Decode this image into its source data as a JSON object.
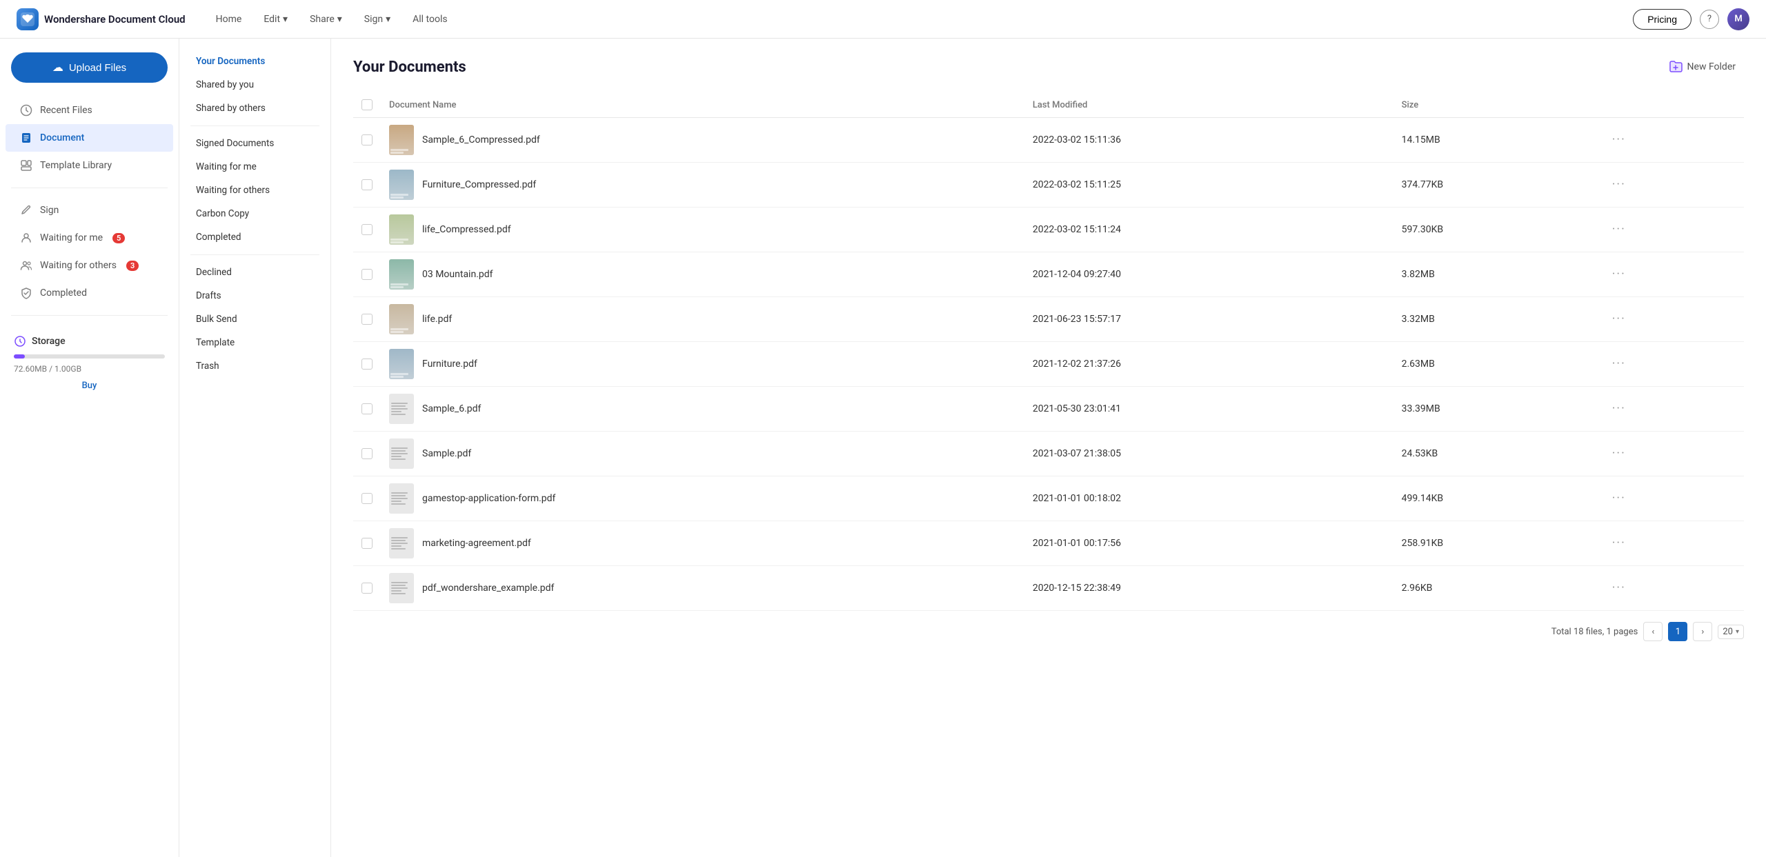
{
  "app": {
    "brand": "Wondershare Document Cloud",
    "brand_icon_text": "W"
  },
  "topnav": {
    "items": [
      {
        "label": "Home",
        "has_dropdown": false
      },
      {
        "label": "Edit",
        "has_dropdown": true
      },
      {
        "label": "Share",
        "has_dropdown": true
      },
      {
        "label": "Sign",
        "has_dropdown": true
      },
      {
        "label": "All tools",
        "has_dropdown": false
      }
    ],
    "pricing_label": "Pricing",
    "help_icon": "?",
    "avatar_text": "M"
  },
  "sidebar": {
    "upload_label": "Upload Files",
    "items": [
      {
        "label": "Recent Files",
        "icon": "clock"
      },
      {
        "label": "Document",
        "icon": "document",
        "active": true
      },
      {
        "label": "Template Library",
        "icon": "template"
      }
    ],
    "sign_items": [
      {
        "label": "Sign",
        "icon": "sign"
      },
      {
        "label": "Waiting for me",
        "icon": "person",
        "badge": "5"
      },
      {
        "label": "Waiting for others",
        "icon": "person-group",
        "badge": "3"
      },
      {
        "label": "Completed",
        "icon": "shield"
      }
    ],
    "storage": {
      "title": "Storage",
      "used": "72.60MB",
      "total": "1.00GB",
      "display": "72.60MB / 1.00GB",
      "percent": 7.28,
      "buy_label": "Buy"
    }
  },
  "second_sidebar": {
    "items": [
      {
        "label": "Your Documents",
        "active": true
      },
      {
        "label": "Shared by you"
      },
      {
        "label": "Shared by others"
      }
    ],
    "signed_section": [
      {
        "label": "Signed Documents"
      },
      {
        "label": "Waiting for me"
      },
      {
        "label": "Waiting for others"
      },
      {
        "label": "Carbon Copy"
      },
      {
        "label": "Completed"
      }
    ],
    "other_section": [
      {
        "label": "Declined"
      },
      {
        "label": "Drafts"
      },
      {
        "label": "Bulk Send"
      },
      {
        "label": "Template"
      },
      {
        "label": "Trash"
      }
    ]
  },
  "content": {
    "title": "Your Documents",
    "new_folder_label": "New Folder",
    "table": {
      "columns": [
        {
          "key": "name",
          "label": "Document Name"
        },
        {
          "key": "modified",
          "label": "Last Modified"
        },
        {
          "key": "size",
          "label": "Size"
        }
      ],
      "rows": [
        {
          "name": "Sample_6_Compressed.pdf",
          "modified": "2022-03-02 15:11:36",
          "size": "14.15MB",
          "thumb_type": "image"
        },
        {
          "name": "Furniture_Compressed.pdf",
          "modified": "2022-03-02 15:11:25",
          "size": "374.77KB",
          "thumb_type": "image"
        },
        {
          "name": "life_Compressed.pdf",
          "modified": "2022-03-02 15:11:24",
          "size": "597.30KB",
          "thumb_type": "image"
        },
        {
          "name": "03 Mountain.pdf",
          "modified": "2021-12-04 09:27:40",
          "size": "3.82MB",
          "thumb_type": "image"
        },
        {
          "name": "life.pdf",
          "modified": "2021-06-23 15:57:17",
          "size": "3.32MB",
          "thumb_type": "image"
        },
        {
          "name": "Furniture.pdf",
          "modified": "2021-12-02 21:37:26",
          "size": "2.63MB",
          "thumb_type": "image"
        },
        {
          "name": "Sample_6.pdf",
          "modified": "2021-05-30 23:01:41",
          "size": "33.39MB",
          "thumb_type": "doc"
        },
        {
          "name": "Sample.pdf",
          "modified": "2021-03-07 21:38:05",
          "size": "24.53KB",
          "thumb_type": "lines"
        },
        {
          "name": "gamestop-application-form.pdf",
          "modified": "2021-01-01 00:18:02",
          "size": "499.14KB",
          "thumb_type": "lines"
        },
        {
          "name": "marketing-agreement.pdf",
          "modified": "2021-01-01 00:17:56",
          "size": "258.91KB",
          "thumb_type": "lines"
        },
        {
          "name": "pdf_wondershare_example.pdf",
          "modified": "2020-12-15 22:38:49",
          "size": "2.96KB",
          "thumb_type": "lines"
        }
      ]
    },
    "pagination": {
      "total_label": "Total 18 files, 1 pages",
      "current_page": 1,
      "per_page": 20
    }
  },
  "icons": {
    "cloud_upload": "☁",
    "chevron_down": "▾",
    "chevron_left": "‹",
    "chevron_right": "›",
    "folder_new": "📁",
    "ellipsis": "···"
  }
}
